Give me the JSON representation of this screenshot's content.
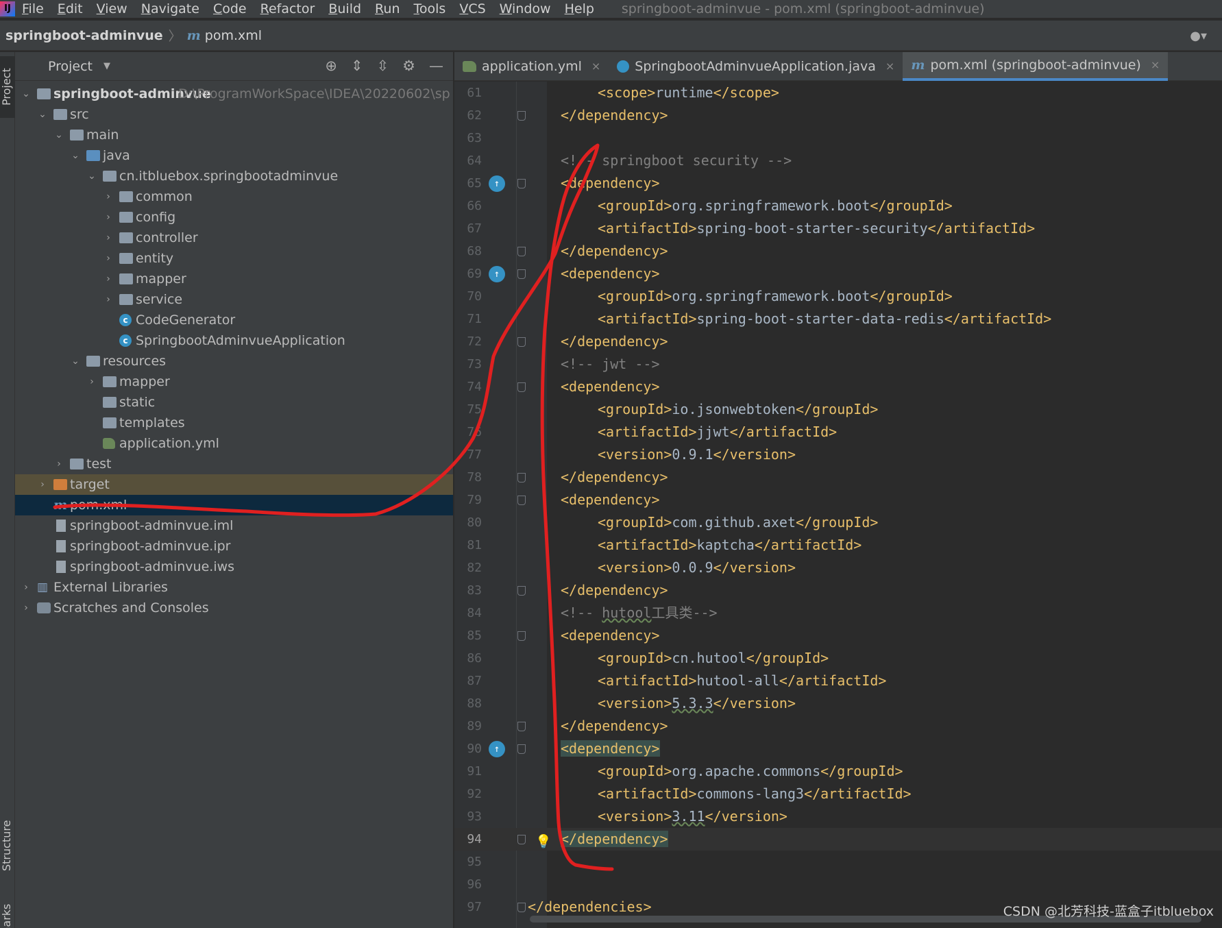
{
  "menu": {
    "items": [
      "File",
      "Edit",
      "View",
      "Navigate",
      "Code",
      "Refactor",
      "Build",
      "Run",
      "Tools",
      "VCS",
      "Window",
      "Help"
    ],
    "window_title": "springboot-adminvue - pom.xml (springboot-adminvue)"
  },
  "navbar": {
    "project": "springboot-adminvue",
    "file": "pom.xml",
    "m_glyph": "m"
  },
  "left_strip": {
    "project": "Project",
    "structure": "Structure",
    "bookmarks": "Bookmarks"
  },
  "project_panel": {
    "title": "Project",
    "tree": [
      {
        "label": "springboot-adminvue",
        "path": "D:\\ProgramWorkSpace\\IDEA\\20220602\\sp",
        "icon": "project-folder-icon"
      },
      {
        "label": "src",
        "icon": "folder-icon"
      },
      {
        "label": "main",
        "icon": "folder-icon"
      },
      {
        "label": "java",
        "icon": "source-folder-icon"
      },
      {
        "label": "cn.itbluebox.springbootadminvue",
        "icon": "package-icon"
      },
      {
        "label": "common",
        "icon": "package-icon"
      },
      {
        "label": "config",
        "icon": "package-icon"
      },
      {
        "label": "controller",
        "icon": "package-icon"
      },
      {
        "label": "entity",
        "icon": "package-icon"
      },
      {
        "label": "mapper",
        "icon": "package-icon"
      },
      {
        "label": "service",
        "icon": "package-icon"
      },
      {
        "label": "CodeGenerator",
        "icon": "class-icon"
      },
      {
        "label": "SpringbootAdminvueApplication",
        "icon": "spring-class-icon"
      },
      {
        "label": "resources",
        "icon": "resources-folder-icon"
      },
      {
        "label": "mapper",
        "icon": "folder-icon"
      },
      {
        "label": "static",
        "icon": "folder-icon"
      },
      {
        "label": "templates",
        "icon": "folder-icon"
      },
      {
        "label": "application.yml",
        "icon": "yml-icon"
      },
      {
        "label": "test",
        "icon": "folder-icon"
      },
      {
        "label": "target",
        "icon": "excluded-folder-icon"
      },
      {
        "label": "pom.xml",
        "icon": "maven-icon"
      },
      {
        "label": "springboot-adminvue.iml",
        "icon": "file-icon"
      },
      {
        "label": "springboot-adminvue.ipr",
        "icon": "file-icon"
      },
      {
        "label": "springboot-adminvue.iws",
        "icon": "file-icon"
      },
      {
        "label": "External Libraries",
        "icon": "library-icon"
      },
      {
        "label": "Scratches and Consoles",
        "icon": "scratch-icon"
      }
    ]
  },
  "editor_tabs": [
    {
      "label": "application.yml",
      "icon": "yml-icon",
      "close": "×"
    },
    {
      "label": "SpringbootAdminvueApplication.java",
      "icon": "spring-class-icon",
      "close": "×"
    },
    {
      "label": "pom.xml (springboot-adminvue)",
      "icon": "maven-icon",
      "close": "×"
    }
  ],
  "editor": {
    "line_numbers": [
      "61",
      "62",
      "63",
      "64",
      "65",
      "66",
      "67",
      "68",
      "69",
      "70",
      "71",
      "72",
      "73",
      "74",
      "75",
      "76",
      "77",
      "78",
      "79",
      "80",
      "81",
      "82",
      "83",
      "84",
      "85",
      "86",
      "87",
      "88",
      "89",
      "90",
      "91",
      "92",
      "93",
      "94",
      "95",
      "96",
      "97"
    ],
    "lines": {
      "l61_open": "<scope>",
      "l61_val": "runtime",
      "l61_close": "</scope>",
      "l62": "</dependency>",
      "l64": "<!-- springboot security -->",
      "l65": "<dependency>",
      "l66_open": "<groupId>",
      "l66_val": "org.springframework.boot",
      "l66_close": "</groupId>",
      "l67_open": "<artifactId>",
      "l67_val": "spring-boot-starter-security",
      "l67_close": "</artifactId>",
      "l68": "</dependency>",
      "l69": "<dependency>",
      "l70_open": "<groupId>",
      "l70_val": "org.springframework.boot",
      "l70_close": "</groupId>",
      "l71_open": "<artifactId>",
      "l71_val": "spring-boot-starter-data-redis",
      "l71_close": "</artifactId>",
      "l72": "</dependency>",
      "l73": "<!-- jwt -->",
      "l74": "<dependency>",
      "l75_open": "<groupId>",
      "l75_val": "io.jsonwebtoken",
      "l75_close": "</groupId>",
      "l76_open": "<artifactId>",
      "l76_val": "jjwt",
      "l76_close": "</artifactId>",
      "l77_open": "<version>",
      "l77_val": "0.9.1",
      "l77_close": "</version>",
      "l78": "</dependency>",
      "l79": "<dependency>",
      "l80_open": "<groupId>",
      "l80_val": "com.github.axet",
      "l80_close": "</groupId>",
      "l81_open": "<artifactId>",
      "l81_val": "kaptcha",
      "l81_close": "</artifactId>",
      "l82_open": "<version>",
      "l82_val": "0.0.9",
      "l82_close": "</version>",
      "l83": "</dependency>",
      "l84_a": "<!-- ",
      "l84_b": "hutool",
      "l84_c": "工具类-->",
      "l85": "<dependency>",
      "l86_open": "<groupId>",
      "l86_val": "cn.hutool",
      "l86_close": "</groupId>",
      "l87_open": "<artifactId>",
      "l87_val": "hutool-all",
      "l87_close": "</artifactId>",
      "l88_open": "<version>",
      "l88_val": "5.3.3",
      "l88_close": "</version>",
      "l89": "</dependency>",
      "l90": "<dependency>",
      "l91_open": "<groupId>",
      "l91_val": "org.apache.commons",
      "l91_close": "</groupId>",
      "l92_open": "<artifactId>",
      "l92_val": "commons-lang3",
      "l92_close": "</artifactId>",
      "l93_open": "<version>",
      "l93_val": "3.11",
      "l93_close": "</version>",
      "l94": "</dependency>",
      "l97": "</dependencies>"
    },
    "current_line": "94"
  },
  "watermark": "CSDN @北芳科技-蓝盒子itbluebox",
  "colors": {
    "annotation": "#e02020",
    "tag": "#e8bf6a",
    "comment": "#808080",
    "selection": "#0d293e"
  }
}
